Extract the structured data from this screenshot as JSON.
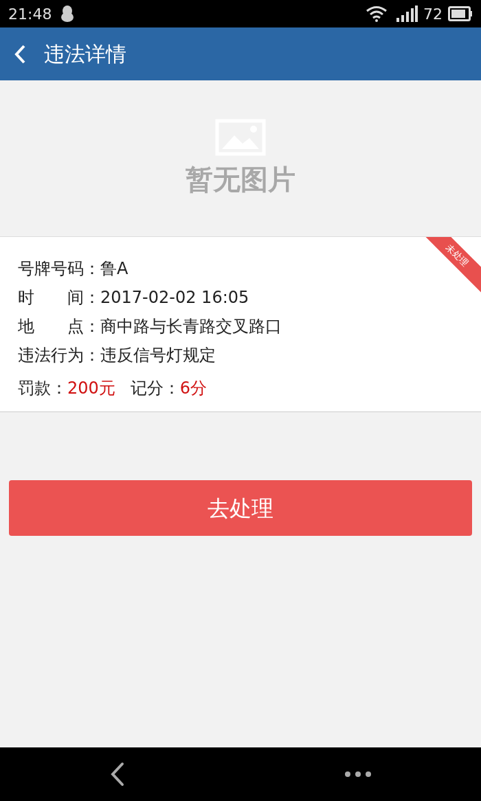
{
  "status_bar": {
    "time": "21:48",
    "battery": "72"
  },
  "header": {
    "title": "违法详情"
  },
  "photo": {
    "placeholder": "暂无图片"
  },
  "record": {
    "status": "未处理",
    "fields": [
      {
        "label": "号牌号码",
        "value": "：鲁A"
      },
      {
        "label": "时间",
        "value": "：2017-02-02 16:05"
      },
      {
        "label": "地点",
        "value": "：商中路与长青路交叉路口"
      },
      {
        "label": "违法行为",
        "value": "：违反信号灯规定"
      }
    ],
    "penalties": [
      {
        "label": "罚款：",
        "value": "200元"
      },
      {
        "label": "记分：",
        "value": "6分"
      }
    ]
  },
  "action_button": "去处理"
}
